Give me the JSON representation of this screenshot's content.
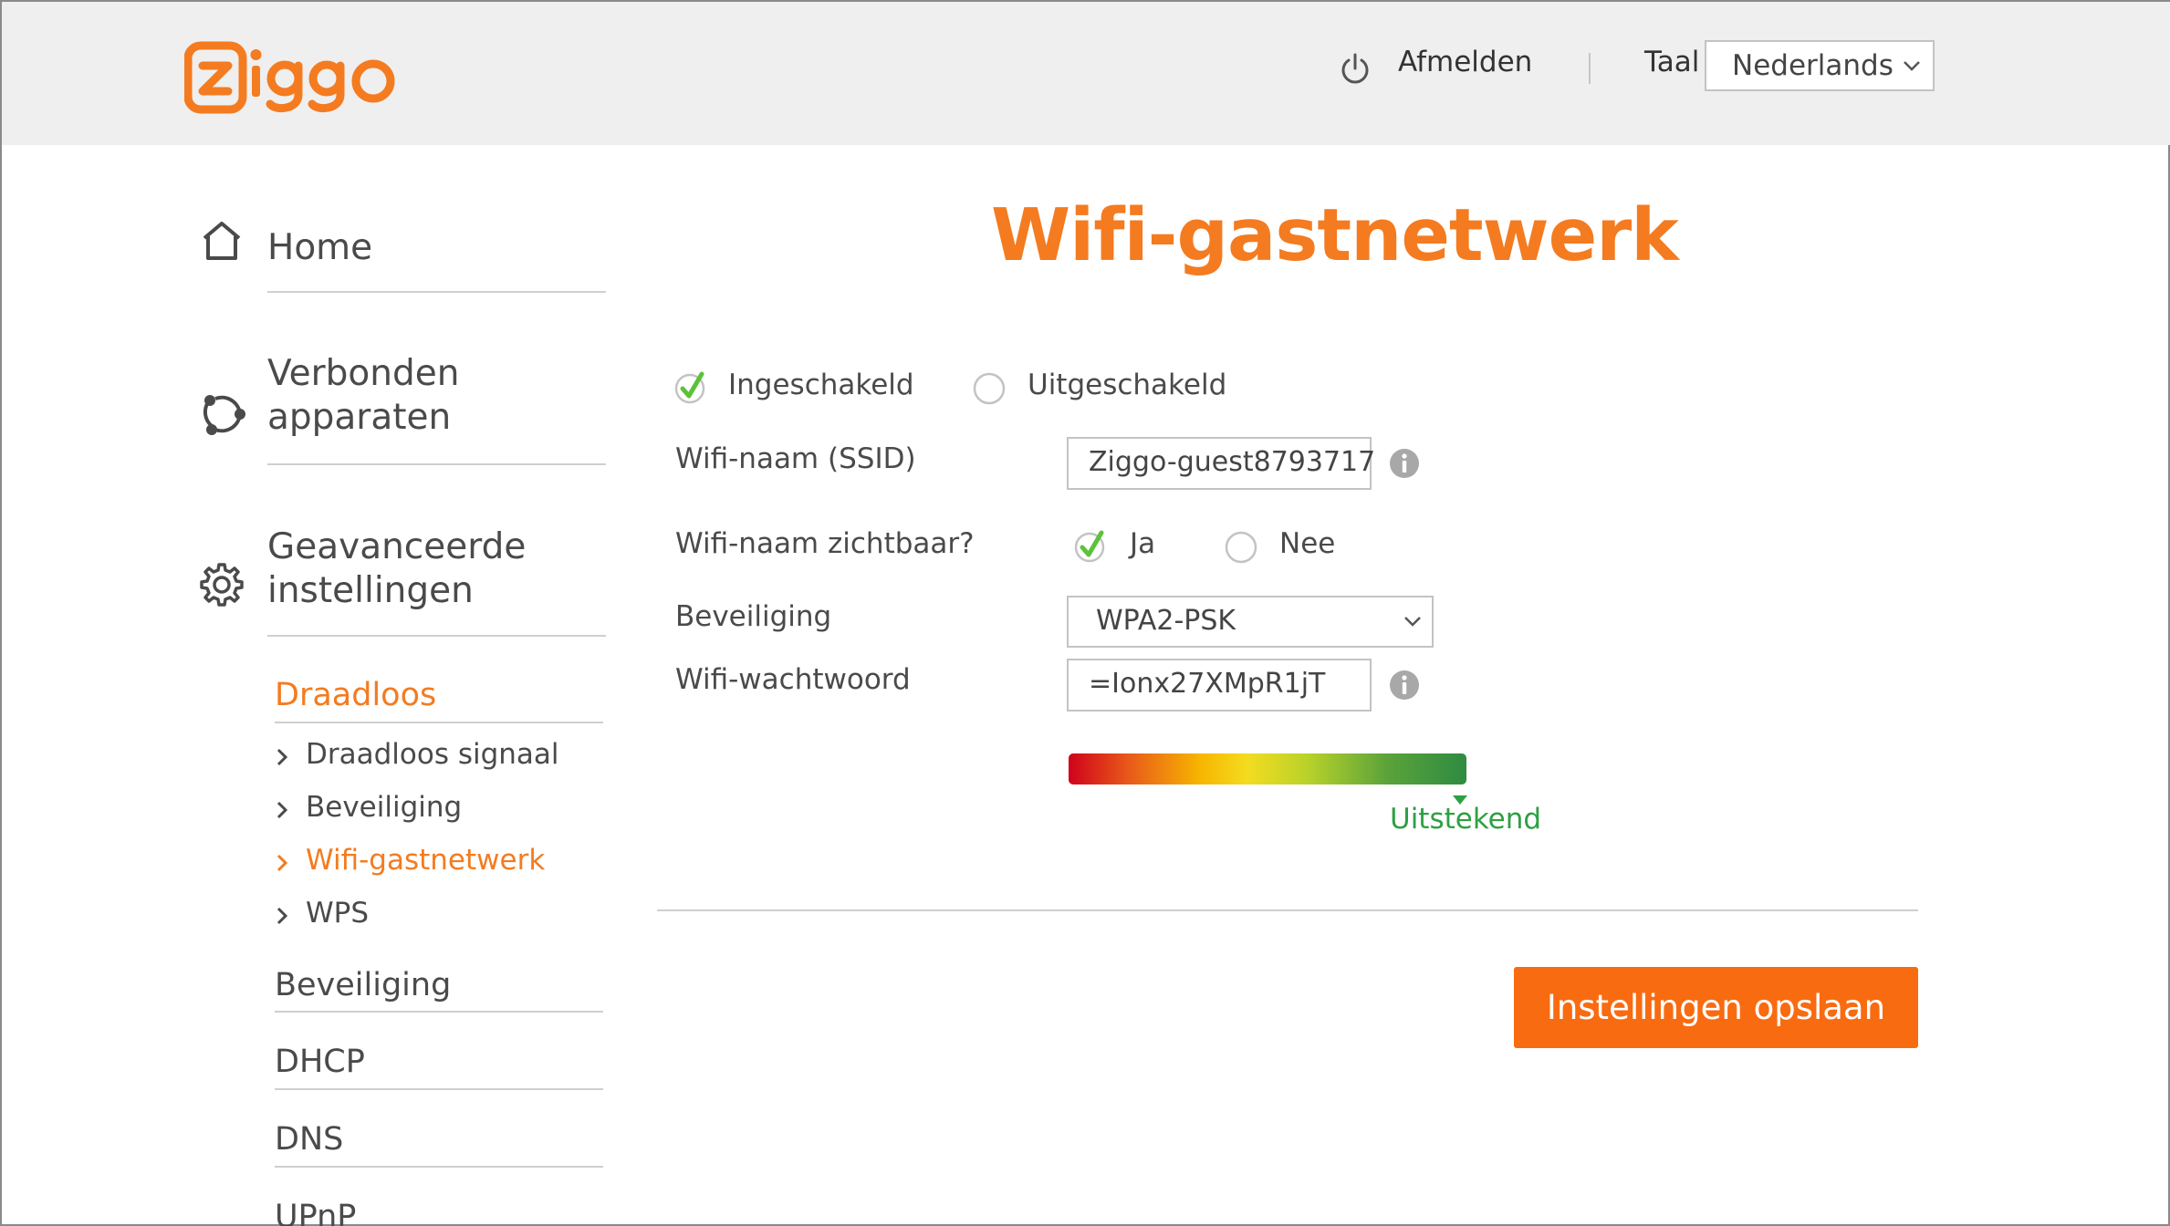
{
  "header": {
    "logo_text": "ziggo",
    "logout_label": "Afmelden",
    "language_label": "Taal",
    "language_selected": "Nederlands",
    "icons": {
      "logout": "power-icon",
      "language_dropdown": "chevron-down-icon"
    }
  },
  "sidebar": {
    "main_items": [
      {
        "label": "Home",
        "icon": "home-icon"
      },
      {
        "label_line1": "Verbonden",
        "label_line2": "apparaten",
        "icon": "connected-devices-icon"
      },
      {
        "label_line1": "Geavanceerde",
        "label_line2": "instellingen",
        "icon": "gear-icon"
      }
    ],
    "section_active": "Draadloos",
    "sub_items": [
      {
        "label": "Draadloos signaal",
        "active": false
      },
      {
        "label": "Beveiliging",
        "active": false
      },
      {
        "label": "Wifi-gastnetwerk",
        "active": true
      },
      {
        "label": "WPS",
        "active": false
      }
    ],
    "other_sections": [
      "Beveiliging",
      "DHCP",
      "DNS",
      "UPnP"
    ]
  },
  "main": {
    "title": "Wifi-gastnetwerk",
    "status": {
      "enabled_label": "Ingeschakeld",
      "disabled_label": "Uitgeschakeld",
      "selected": "Ingeschakeld"
    },
    "ssid": {
      "label": "Wifi-naam (SSID)",
      "value": "Ziggo-guest8793717"
    },
    "visible": {
      "label": "Wifi-naam zichtbaar?",
      "yes_label": "Ja",
      "no_label": "Nee",
      "selected": "Ja"
    },
    "security": {
      "label": "Beveiliging",
      "value": "WPA2-PSK"
    },
    "password": {
      "label": "Wifi-wachtwoord",
      "value": "=Ionx27XMpR1jT"
    },
    "strength": {
      "label": "Uitstekend",
      "level": 0.98
    },
    "save_button_label": "Instellingen opslaan"
  },
  "colors": {
    "brand_orange": "#f47b20",
    "button_orange": "#f96b10",
    "check_green": "#5cc23a",
    "strength_green": "#2ea043",
    "header_bg": "#efefef"
  }
}
